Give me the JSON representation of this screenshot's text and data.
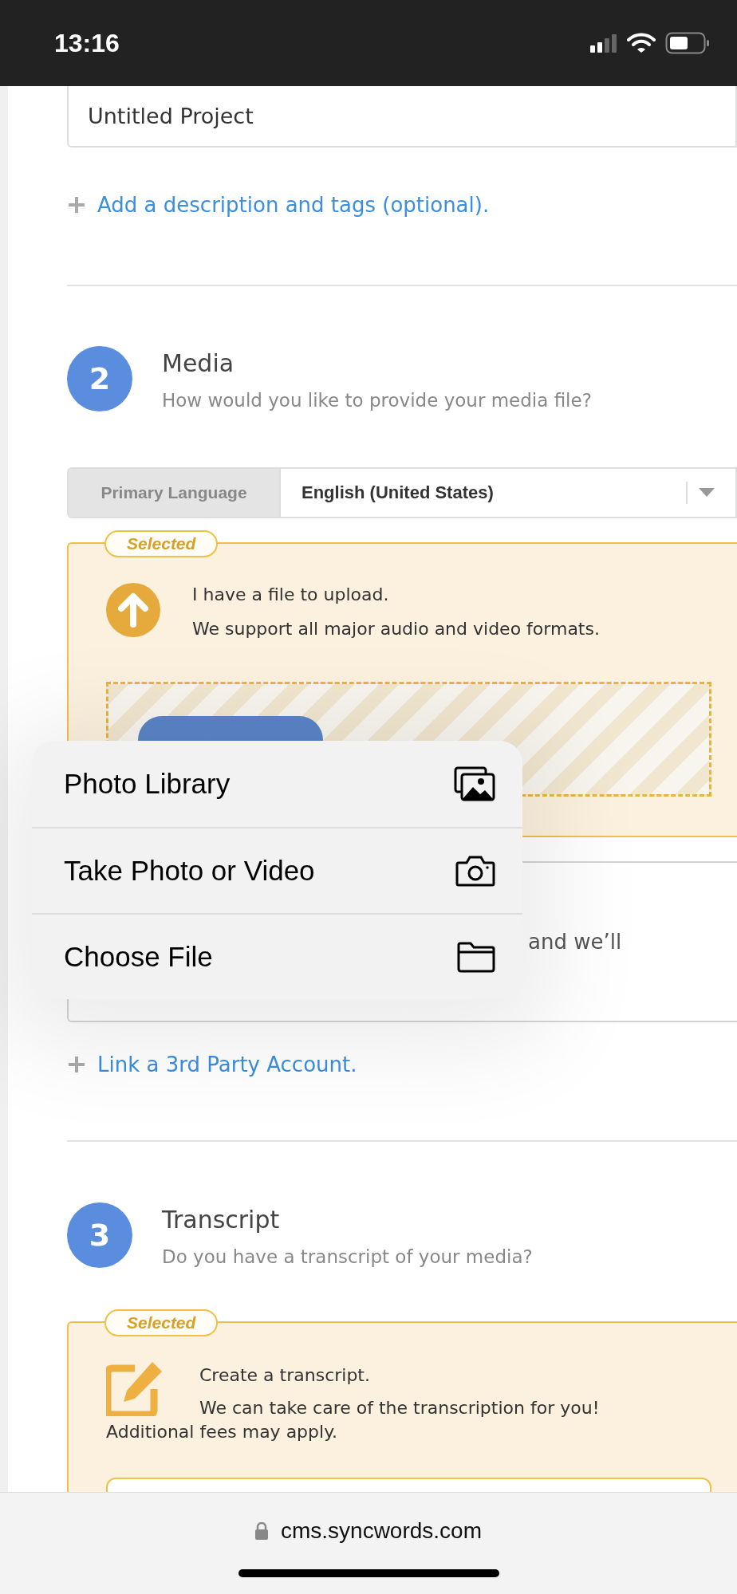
{
  "status_bar": {
    "time": "13:16"
  },
  "project": {
    "title_value": "Untitled Project",
    "add_description_link": "Add a description and tags (optional)."
  },
  "media_step": {
    "number": "2",
    "title": "Media",
    "subtitle": "How would you like to provide your media file?",
    "language": {
      "label": "Primary Language",
      "value": "English (United States)"
    },
    "options": [
      {
        "kind": "upload",
        "selected": true,
        "badge": "Selected",
        "heading": "I have a file to upload.",
        "description": "We support all major audio and video formats."
      },
      {
        "kind": "partial",
        "selected": false,
        "visible_text": "and we’ll"
      }
    ],
    "link": "Link a 3rd Party Account."
  },
  "transcript_step": {
    "number": "3",
    "title": "Transcript",
    "subtitle": "Do you have a transcript of your media?",
    "options": [
      {
        "kind": "create",
        "selected": true,
        "badge": "Selected",
        "heading": "Create a transcript.",
        "description": "We can take care of the transcription for you!",
        "note": "Additional fees may apply."
      }
    ]
  },
  "file_menu": {
    "items": [
      {
        "kind": "photos",
        "label": "Photo Library"
      },
      {
        "kind": "camera",
        "label": "Take Photo or Video"
      },
      {
        "kind": "folder",
        "label": "Choose File"
      }
    ]
  },
  "browser_bar": {
    "url": "cms.syncwords.com"
  }
}
